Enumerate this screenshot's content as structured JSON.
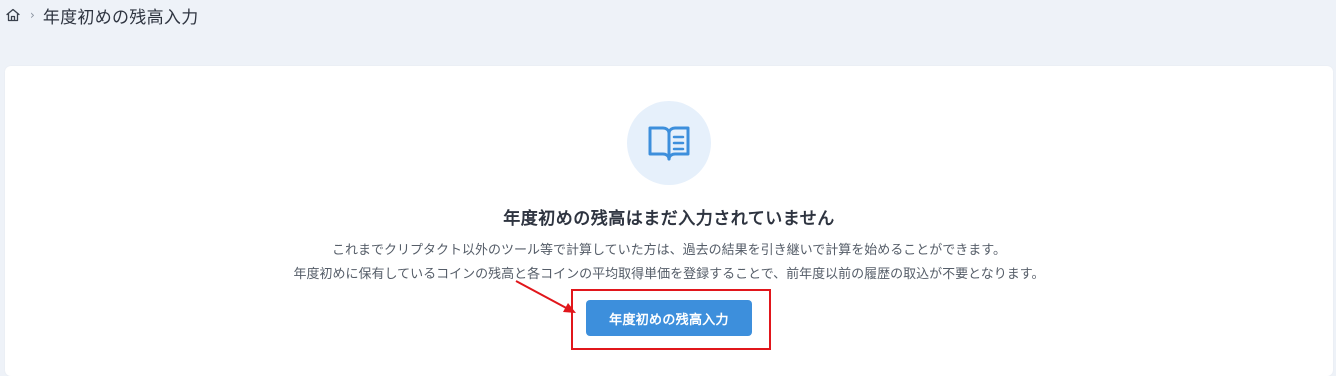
{
  "breadcrumb": {
    "home_icon": "home-icon",
    "separator": "›",
    "current": "年度初めの残高入力"
  },
  "empty_state": {
    "icon": "book-open-icon",
    "title": "年度初めの残高はまだ入力されていません",
    "description_line1": "これまでクリプタクト以外のツール等で計算していた方は、過去の結果を引き継いで計算を始めることができます。",
    "description_line2": "年度初めに保有しているコインの残高と各コインの平均取得単価を登録することで、前年度以前の履歴の取込が不要となります。",
    "button_label": "年度初めの残高入力"
  },
  "annotation": {
    "highlight_color": "#e1161b"
  },
  "colors": {
    "page_background": "#eef2f8",
    "card_background": "#ffffff",
    "primary": "#3d8fdc",
    "icon_circle": "#e6f0fb"
  }
}
